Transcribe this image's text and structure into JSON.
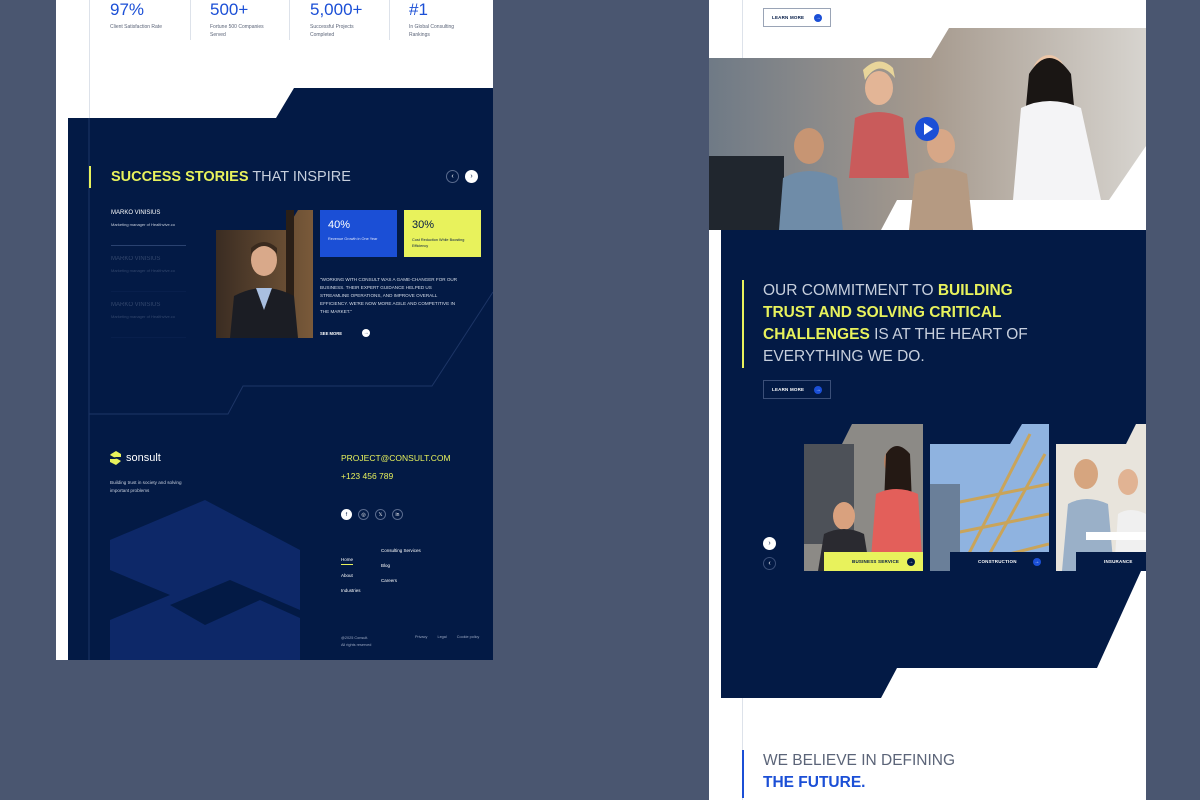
{
  "left": {
    "stats": [
      {
        "value": "97%",
        "label": "Client Satisfaction Rate"
      },
      {
        "value": "500+",
        "label": "Fortune 500 Companies Served"
      },
      {
        "value": "5,000+",
        "label": "Successful Projects Completed"
      },
      {
        "value": "#1",
        "label": "In Global Consulting Rankings"
      }
    ],
    "stories": {
      "title_highlight": "SUCCESS STORIES",
      "title_rest": "THAT INSPIRE",
      "people": [
        {
          "name": "MARKO VINISIUS",
          "role": "Marketing manager of Healthvive.co"
        },
        {
          "name": "MARKO VINISIUS",
          "role": "Marketing manager of Healthvive.co"
        },
        {
          "name": "MARKO VINISIUS",
          "role": "Marketing manager of Healthvive.co"
        }
      ],
      "metric1": {
        "value": "40%",
        "label": "Revenue Growth in One Year"
      },
      "metric2": {
        "value": "30%",
        "label": "Cost Reduction While Boosting Efficiency"
      },
      "quote": "\"WORKING WITH CONSULT WAS A GAME-CHANGER FOR OUR BUSINESS. THEIR EXPERT GUIDANCE HELPED US STREAMLINE OPERATIONS, AND IMPROVE OVERALL EFFICIENCY. WE'RE NOW MORE AGILE AND COMPETITIVE IN THE MARKET.\"",
      "see_more": "SEE MORE"
    },
    "footer": {
      "logo": "sonsult",
      "tagline": "Building trust in society and solving important problems",
      "email": "PROJECT@CONSULT.COM",
      "phone": "+123 456 789",
      "nav_col1": [
        "Home",
        "About",
        "Industries"
      ],
      "nav_col2": [
        "Consulting Services",
        "Blog",
        "Careers"
      ],
      "copyright1": "@2025 Consult.",
      "copyright2": "All rights reserved",
      "legal": [
        "Privacy",
        "Legal",
        "Cookie policy"
      ],
      "socials": [
        "f",
        "◎",
        "𝕏",
        "in"
      ]
    }
  },
  "right": {
    "top_button": "LEARN MORE",
    "commitment": {
      "l1a": "OUR COMMITMENT TO",
      "l1b": "BUILDING",
      "l2": "TRUST AND SOLVING CRITICAL",
      "l3a": "CHALLENGES",
      "l3b": "IS AT THE HEART OF",
      "l4": "EVERYTHING WE DO.",
      "button": "LEARN MORE"
    },
    "cards": [
      {
        "label": "BUSINESS SERVICE"
      },
      {
        "label": "CONSTRUCTION"
      },
      {
        "label": "INSURANCE"
      }
    ],
    "future": {
      "l1": "WE BELIEVE IN DEFINING",
      "l2": "THE FUTURE."
    }
  },
  "colors": {
    "navy": "#031a45",
    "accent_blue": "#1b4fd6",
    "accent_yellow": "#e8f25c"
  }
}
